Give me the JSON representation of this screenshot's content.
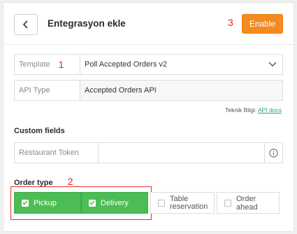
{
  "header": {
    "title": "Entegrasyon ekle",
    "enable_label": "Enable",
    "annotation": "3"
  },
  "template_field": {
    "label": "Template",
    "value": "Poll Accepted Orders v2",
    "annotation": "1"
  },
  "api_type_field": {
    "label": "API Type",
    "value": "Accepted Orders API"
  },
  "teknik": {
    "text": "Teknik Bilgi:",
    "link": "API docs"
  },
  "custom_fields": {
    "title": "Custom fields",
    "restaurant_token_label": "Restaurant Token",
    "restaurant_token_value": ""
  },
  "order_type": {
    "title": "Order type",
    "annotation": "2",
    "options": [
      {
        "label": "Pickup",
        "checked": true
      },
      {
        "label": "Delivery",
        "checked": true
      },
      {
        "label_line1": "Table",
        "label_line2": "reservation",
        "checked": false
      },
      {
        "label": "Order ahead",
        "checked": false
      }
    ]
  },
  "colors": {
    "accent_orange": "#f58a1f",
    "selected_green": "#4cbd55",
    "link_green": "#2aa66a",
    "annotation_red": "#e02020"
  },
  "icons": [
    "chevron-left-icon",
    "chevron-down-icon",
    "info-icon",
    "check-icon"
  ]
}
